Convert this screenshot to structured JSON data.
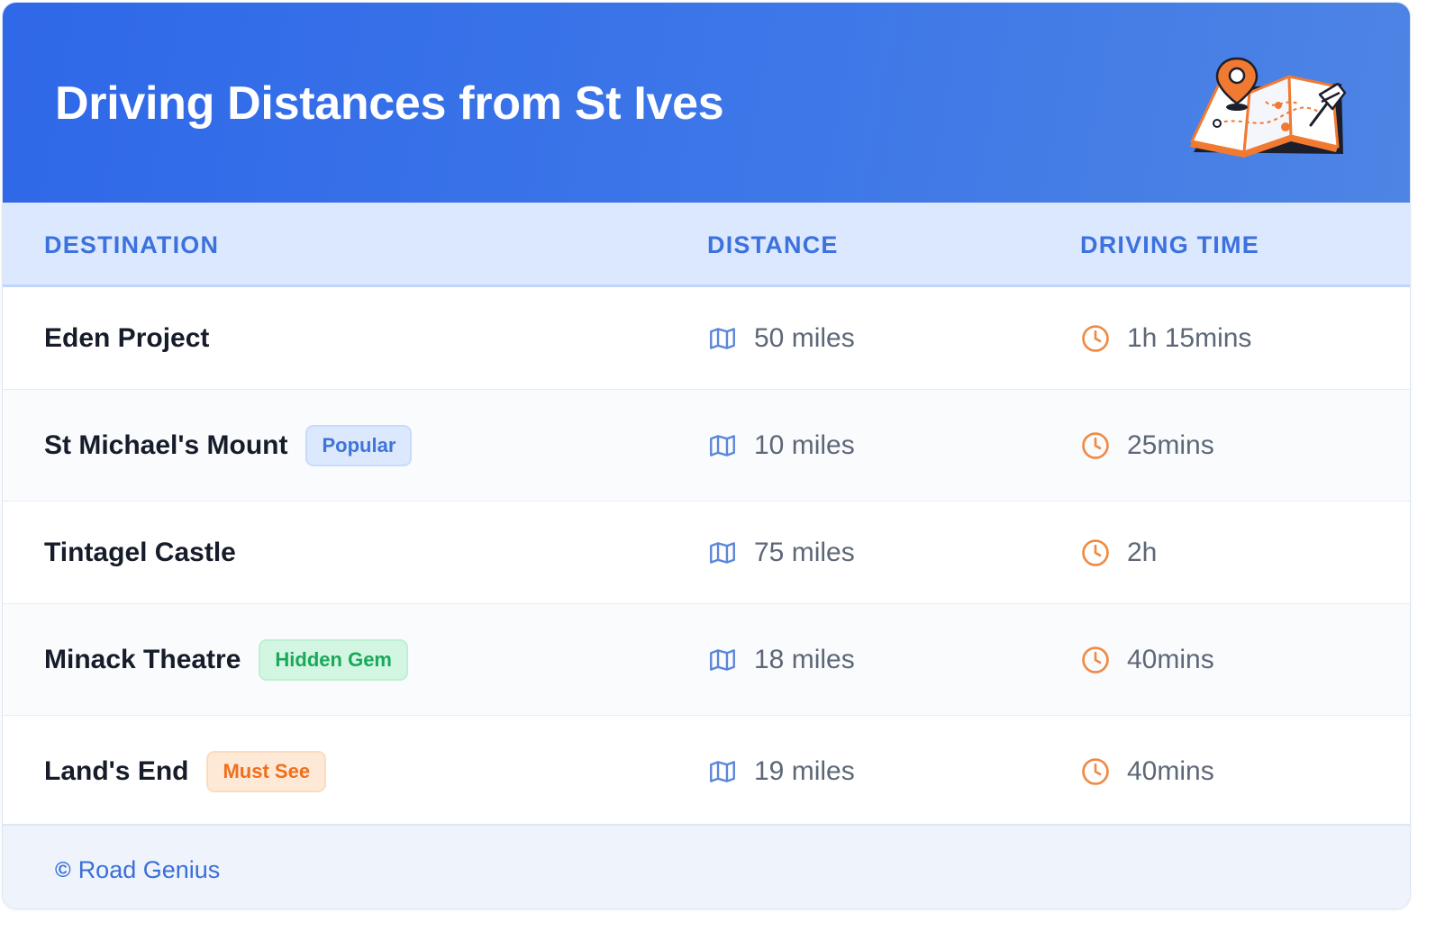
{
  "header": {
    "title": "Driving Distances from St Ives",
    "illustration_icon": "map-pin-illustration-icon"
  },
  "table": {
    "columns": [
      "DESTINATION",
      "DISTANCE",
      "DRIVING TIME"
    ],
    "rows": [
      {
        "destination": "Eden Project",
        "badge": "",
        "badge_color": "",
        "distance": "50 miles",
        "time": "1h 15mins"
      },
      {
        "destination": "St Michael's Mount",
        "badge": "Popular",
        "badge_color": "blue",
        "distance": "10 miles",
        "time": "25mins"
      },
      {
        "destination": "Tintagel Castle",
        "badge": "",
        "badge_color": "",
        "distance": "75 miles",
        "time": "2h"
      },
      {
        "destination": "Minack Theatre",
        "badge": "Hidden Gem",
        "badge_color": "green",
        "distance": "18 miles",
        "time": "40mins"
      },
      {
        "destination": "Land's End",
        "badge": "Must See",
        "badge_color": "orange",
        "distance": "19 miles",
        "time": "40mins"
      }
    ],
    "distance_icon": "map-icon",
    "time_icon": "clock-icon"
  },
  "footer": {
    "copyright_symbol": "©",
    "credit": "Road Genius"
  },
  "colors": {
    "header_bg": "#3470e8",
    "accent_blue": "#3c71de",
    "clock_orange": "#f08a45",
    "map_blue": "#5b86d9"
  }
}
